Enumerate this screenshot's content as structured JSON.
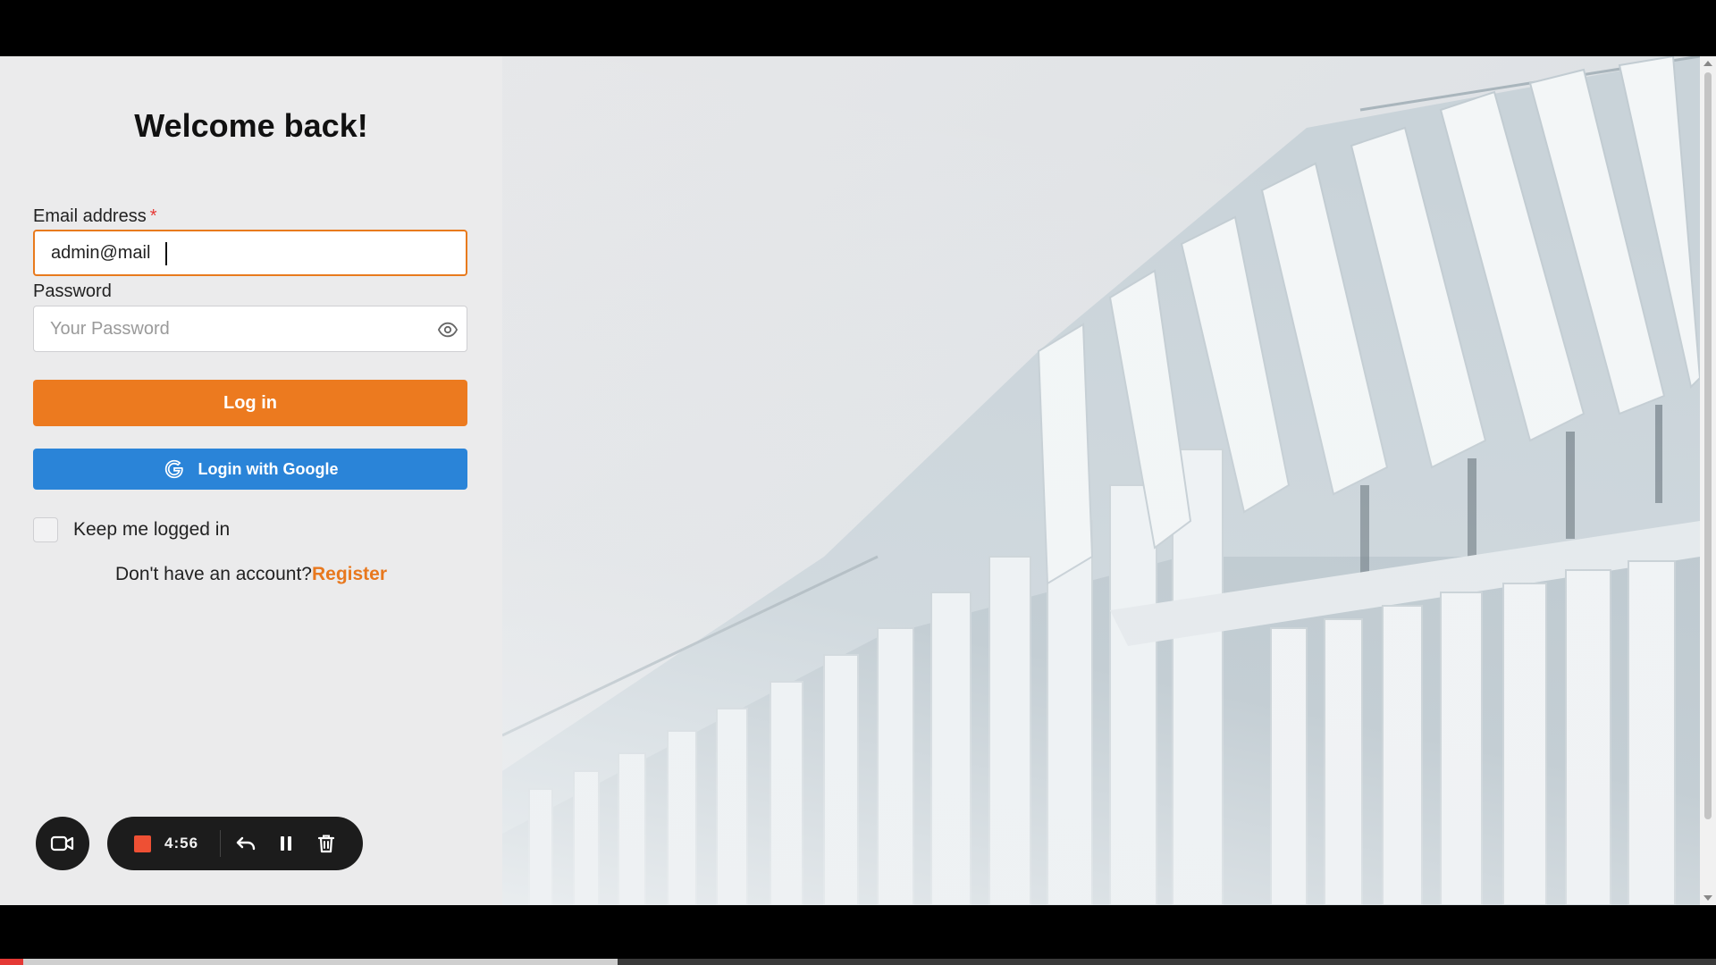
{
  "login": {
    "title": "Welcome back!",
    "email_label": "Email address",
    "email_required_mark": "*",
    "email_value": "admin@mail",
    "password_label": "Password",
    "password_placeholder": "Your Password",
    "login_button": "Log in",
    "google_button": "Login with Google",
    "keep_logged_in": "Keep me logged in",
    "no_account_text": "Don't have an account?",
    "register_link": "Register"
  },
  "recorder": {
    "time": "4:56",
    "icons": [
      "video-camera-icon",
      "stop-icon",
      "undo-icon",
      "pause-icon",
      "trash-icon"
    ]
  },
  "video_progress": 0.36,
  "colors": {
    "accent_orange": "#ec7a1f",
    "google_blue": "#2a84d8",
    "required_red": "#e53935",
    "recorder_bg": "#1c1c1c"
  }
}
